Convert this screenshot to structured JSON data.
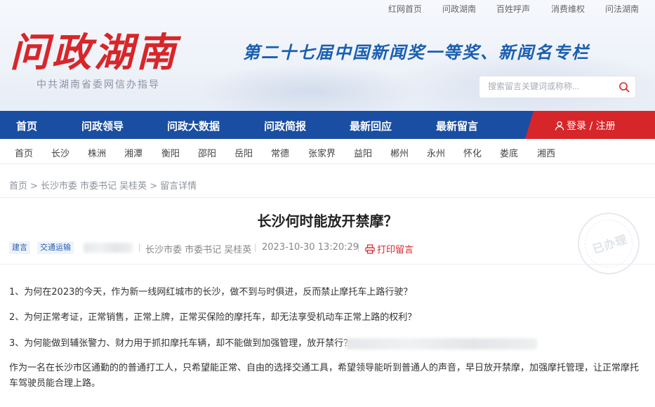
{
  "toplinks": [
    "红网首页",
    "问政湖南",
    "百姓呼声",
    "消费维权",
    "问法湖南"
  ],
  "header": {
    "logo": "问政湖南",
    "logo_sub": "中共湖南省委网信办指导",
    "slogan": "第二十七届中国新闻奖一等奖、新闻名专栏",
    "search_placeholder": "搜索留言关键词或称称..."
  },
  "nav": {
    "items": [
      "首页",
      "问政领导",
      "问政大数据",
      "问政简报",
      "最新回应",
      "最新留言"
    ],
    "login": "登录 / 注册"
  },
  "cities": [
    "首页",
    "长沙",
    "株洲",
    "湘潭",
    "衡阳",
    "邵阳",
    "岳阳",
    "常德",
    "张家界",
    "益阳",
    "郴州",
    "永州",
    "怀化",
    "娄底",
    "湘西"
  ],
  "breadcrumb": [
    "首页",
    "长沙市委 市委书记 吴桂英",
    "留言详情"
  ],
  "article": {
    "title": "长沙何时能放开禁摩？",
    "tags": [
      "建言",
      "交通运输"
    ],
    "recipient": "长沙市委 市委书记 吴桂英",
    "datetime": "2023-10-30 13:20:29",
    "print_label": "打印留言",
    "stamp": "已办理",
    "paragraphs": [
      "1、为何在2023的今天，作为新一线网红城市的长沙，做不到与时俱进，反而禁止摩托车上路行驶？",
      "2、为何正常考证，正常销售，正常上牌，正常买保险的摩托车，却无法享受机动车正常上路的权利？",
      "3、为何能做到辅张警力、财力用于抓扣摩托车辆，却不能做到加强管理，放开禁行？",
      "作为一名在长沙市区通勤的的普通打工人，只希望能正常、自由的选择交通工具，希望领导能听到普通人的声音，早日放开禁摩，加强摩托管理，让正常摩托车驾驶员能合理上路。"
    ]
  },
  "colors": {
    "brand_blue": "#1a4ea2",
    "brand_red": "#d7262a"
  }
}
